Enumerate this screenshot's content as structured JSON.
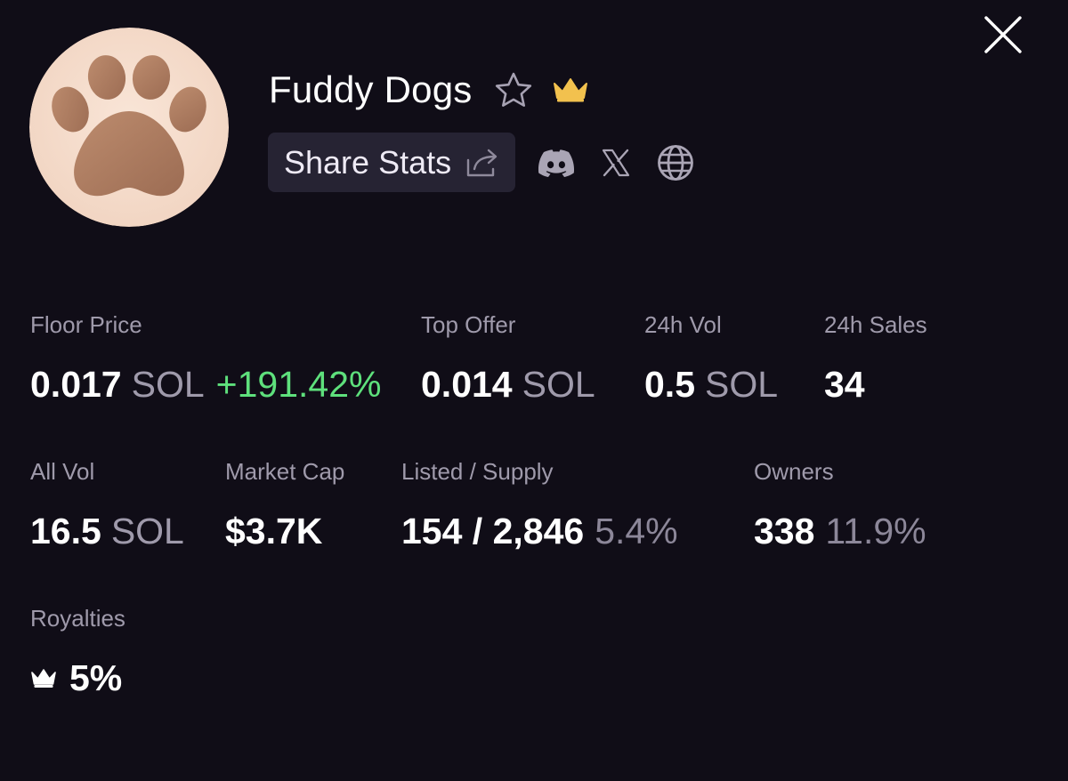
{
  "header": {
    "collection_name": "Fuddy Dogs",
    "share_label": "Share Stats",
    "icons": {
      "close": "close-icon",
      "favorite": "star-icon",
      "badge": "crown-icon",
      "share": "share-icon",
      "discord": "discord-icon",
      "x": "x-icon",
      "website": "globe-icon"
    }
  },
  "colors": {
    "background": "#100d17",
    "label": "#9f9aab",
    "positive": "#5ee07c",
    "badge_gold": "#f2c14e",
    "button_bg": "#262333"
  },
  "stats": {
    "floor_price": {
      "label": "Floor Price",
      "value": "0.017",
      "unit": "SOL",
      "change": "+191.42%"
    },
    "top_offer": {
      "label": "Top Offer",
      "value": "0.014",
      "unit": "SOL"
    },
    "vol_24h": {
      "label": "24h Vol",
      "value": "0.5",
      "unit": "SOL"
    },
    "sales_24h": {
      "label": "24h Sales",
      "value": "34"
    },
    "all_vol": {
      "label": "All Vol",
      "value": "16.5",
      "unit": "SOL"
    },
    "market_cap": {
      "label": "Market Cap",
      "value": "$3.7K"
    },
    "listed_supply": {
      "label": "Listed / Supply",
      "value": "154 / 2,846",
      "percent": "5.4%"
    },
    "owners": {
      "label": "Owners",
      "value": "338",
      "percent": "11.9%"
    },
    "royalties": {
      "label": "Royalties",
      "value": "5%"
    }
  }
}
